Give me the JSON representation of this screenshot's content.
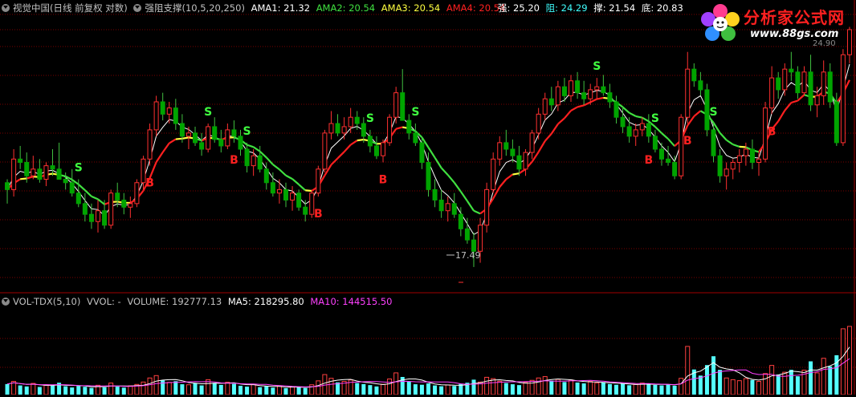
{
  "main_header": {
    "title": "视觉中国(日线 前复权 对数)",
    "indicator": "强阻支撑(10,5,20,250)",
    "ama1_label": "AMA1: 21.32",
    "ama2_label": "AMA2: 20.54",
    "ama3_label": "AMA3: 20.54",
    "ama4_label": "AMA4: 20.54"
  },
  "sr_header": {
    "strong_label": "强: 25.20",
    "resist_label": "阻: 24.29",
    "support_label": "撑: 21.54",
    "bottom_label": "底: 20.83"
  },
  "volume_header": {
    "indicator": "VOL-TDX(5,10)",
    "vvol_label": "VVOL: -",
    "volume_label": "VOLUME: 192777.13",
    "ma5_label": "MA5: 218295.80",
    "ma10_label": "MA10: 144515.50"
  },
  "logo": {
    "title": "分析家公式网",
    "url": "www.88gs.com"
  },
  "colors": {
    "up": "#ff3030",
    "down": "#00a400",
    "volume_up": "#ff4040",
    "volume_down": "#54ffff",
    "ama_white": "#ffffff",
    "ama_green": "#40e040",
    "ama_yellow": "#ffff40",
    "ama_red": "#ff2020",
    "grid": "#7a0000",
    "ma5": "#ffffff",
    "ma10": "#ff40ff",
    "signal_s": "#40ff40",
    "signal_b": "#ff2020"
  },
  "annotations": {
    "low_price": "17.49",
    "high_price": "24.90"
  },
  "signals": [
    {
      "text": "S",
      "index": 11
    },
    {
      "text": "S",
      "index": 31
    },
    {
      "text": "S",
      "index": 37
    },
    {
      "text": "S",
      "index": 56
    },
    {
      "text": "S",
      "index": 63
    },
    {
      "text": "S",
      "index": 91
    },
    {
      "text": "S",
      "index": 100
    },
    {
      "text": "S",
      "index": 109
    },
    {
      "text": "B",
      "index": 22
    },
    {
      "text": "B",
      "index": 35
    },
    {
      "text": "B",
      "index": 48
    },
    {
      "text": "B",
      "index": 58
    },
    {
      "text": "B",
      "index": 99
    },
    {
      "text": "B",
      "index": 105
    },
    {
      "text": "B",
      "index": 118
    }
  ],
  "chart_data": {
    "type": "candlestick",
    "note": "Approximate price (yuan) and volume bars read from screenshot",
    "ylim": [
      16.9,
      25.3
    ],
    "volume_ylim": [
      0,
      520000
    ],
    "candles": [
      [
        19.8,
        19.9,
        19.2,
        19.6
      ],
      [
        19.6,
        20.8,
        19.4,
        20.5
      ],
      [
        20.5,
        20.9,
        20.2,
        20.4
      ],
      [
        20.4,
        20.7,
        19.8,
        20.0
      ],
      [
        20.0,
        20.6,
        19.9,
        20.2
      ],
      [
        20.2,
        20.5,
        19.8,
        19.9
      ],
      [
        19.9,
        20.4,
        19.7,
        20.3
      ],
      [
        20.3,
        20.8,
        20.0,
        20.2
      ],
      [
        20.2,
        21.0,
        19.9,
        19.9
      ],
      [
        19.9,
        20.1,
        19.6,
        19.8
      ],
      [
        19.8,
        20.2,
        19.4,
        19.5
      ],
      [
        19.5,
        19.9,
        19.1,
        19.2
      ],
      [
        19.2,
        19.5,
        18.7,
        18.9
      ],
      [
        18.9,
        19.2,
        18.5,
        18.7
      ],
      [
        18.7,
        19.3,
        18.4,
        19.0
      ],
      [
        19.0,
        19.3,
        18.5,
        18.6
      ],
      [
        18.6,
        19.6,
        18.5,
        19.5
      ],
      [
        19.5,
        19.8,
        19.1,
        19.3
      ],
      [
        19.3,
        19.5,
        18.9,
        19.1
      ],
      [
        19.1,
        19.4,
        18.8,
        19.2
      ],
      [
        19.2,
        19.9,
        19.1,
        19.8
      ],
      [
        19.8,
        20.6,
        19.6,
        20.5
      ],
      [
        20.5,
        21.6,
        20.3,
        21.4
      ],
      [
        21.4,
        22.5,
        21.2,
        22.3
      ],
      [
        22.3,
        22.6,
        21.7,
        21.9
      ],
      [
        21.9,
        22.3,
        21.6,
        22.1
      ],
      [
        22.1,
        22.4,
        21.4,
        21.6
      ],
      [
        21.6,
        21.9,
        21.0,
        21.2
      ],
      [
        21.2,
        21.5,
        20.8,
        21.3
      ],
      [
        21.3,
        21.5,
        20.9,
        21.0
      ],
      [
        21.0,
        21.3,
        20.6,
        20.8
      ],
      [
        20.8,
        21.6,
        20.7,
        21.5
      ],
      [
        21.5,
        21.8,
        21.0,
        21.1
      ],
      [
        21.1,
        21.4,
        20.7,
        20.9
      ],
      [
        20.9,
        21.6,
        20.8,
        21.4
      ],
      [
        21.4,
        21.7,
        21.0,
        21.2
      ],
      [
        21.2,
        21.4,
        20.6,
        20.8
      ],
      [
        20.8,
        21.0,
        20.1,
        20.3
      ],
      [
        20.3,
        20.8,
        20.0,
        20.6
      ],
      [
        20.6,
        20.9,
        20.1,
        20.2
      ],
      [
        20.2,
        20.4,
        19.6,
        19.8
      ],
      [
        19.8,
        20.1,
        19.4,
        19.5
      ],
      [
        19.5,
        19.9,
        19.2,
        19.6
      ],
      [
        19.6,
        19.8,
        19.1,
        19.3
      ],
      [
        19.3,
        19.7,
        19.0,
        19.5
      ],
      [
        19.5,
        19.6,
        19.0,
        19.1
      ],
      [
        19.1,
        19.3,
        18.7,
        18.9
      ],
      [
        18.9,
        19.6,
        18.8,
        19.5
      ],
      [
        19.5,
        20.3,
        19.4,
        20.2
      ],
      [
        20.2,
        21.4,
        20.1,
        21.3
      ],
      [
        21.3,
        22.0,
        21.1,
        21.6
      ],
      [
        21.6,
        21.9,
        21.2,
        21.3
      ],
      [
        21.3,
        21.8,
        21.1,
        21.5
      ],
      [
        21.5,
        22.1,
        21.3,
        21.8
      ],
      [
        21.8,
        22.0,
        21.4,
        21.6
      ],
      [
        21.6,
        21.8,
        21.0,
        21.2
      ],
      [
        21.2,
        21.4,
        20.7,
        20.9
      ],
      [
        20.9,
        21.2,
        20.5,
        20.6
      ],
      [
        20.6,
        21.1,
        20.4,
        21.0
      ],
      [
        21.0,
        21.9,
        20.9,
        21.8
      ],
      [
        21.8,
        22.8,
        21.6,
        22.6
      ],
      [
        22.6,
        23.4,
        22.4,
        21.7
      ],
      [
        21.7,
        21.9,
        21.1,
        21.3
      ],
      [
        21.3,
        21.6,
        20.9,
        21.0
      ],
      [
        21.0,
        21.2,
        20.2,
        20.4
      ],
      [
        20.4,
        20.7,
        19.4,
        19.6
      ],
      [
        19.6,
        19.9,
        19.1,
        19.3
      ],
      [
        19.3,
        19.6,
        18.8,
        19.0
      ],
      [
        19.0,
        19.4,
        18.7,
        19.2
      ],
      [
        19.2,
        19.5,
        18.8,
        18.9
      ],
      [
        18.9,
        19.1,
        18.3,
        18.5
      ],
      [
        18.5,
        18.8,
        18.1,
        18.2
      ],
      [
        18.2,
        18.4,
        17.49,
        17.9
      ],
      [
        17.9,
        18.8,
        17.6,
        18.6
      ],
      [
        18.6,
        19.8,
        18.4,
        19.6
      ],
      [
        19.6,
        20.7,
        19.5,
        20.5
      ],
      [
        20.5,
        21.2,
        20.3,
        21.0
      ],
      [
        21.0,
        21.4,
        20.6,
        20.8
      ],
      [
        20.8,
        21.1,
        20.4,
        20.6
      ],
      [
        20.6,
        20.9,
        20.0,
        20.2
      ],
      [
        20.2,
        20.8,
        20.0,
        20.7
      ],
      [
        20.7,
        21.4,
        20.5,
        21.3
      ],
      [
        21.3,
        22.1,
        21.1,
        21.9
      ],
      [
        21.9,
        22.6,
        21.7,
        22.4
      ],
      [
        22.4,
        22.8,
        22.0,
        22.2
      ],
      [
        22.2,
        23.0,
        22.0,
        22.8
      ],
      [
        22.8,
        23.1,
        22.3,
        22.5
      ],
      [
        22.5,
        23.2,
        22.3,
        23.0
      ],
      [
        23.0,
        23.3,
        22.4,
        22.6
      ],
      [
        22.6,
        23.0,
        22.2,
        22.4
      ],
      [
        22.4,
        22.9,
        22.2,
        22.7
      ],
      [
        22.7,
        23.1,
        22.4,
        22.8
      ],
      [
        22.8,
        23.2,
        22.5,
        22.6
      ],
      [
        22.6,
        22.9,
        22.1,
        22.3
      ],
      [
        22.3,
        22.5,
        21.6,
        21.8
      ],
      [
        21.8,
        22.1,
        21.3,
        21.5
      ],
      [
        21.5,
        21.8,
        21.0,
        21.2
      ],
      [
        21.2,
        21.6,
        20.9,
        21.4
      ],
      [
        21.4,
        21.8,
        21.2,
        21.6
      ],
      [
        21.6,
        21.9,
        21.0,
        21.2
      ],
      [
        21.2,
        21.4,
        20.7,
        20.8
      ],
      [
        20.8,
        21.0,
        20.3,
        20.5
      ],
      [
        20.5,
        20.9,
        20.3,
        20.4
      ],
      [
        20.4,
        20.6,
        19.9,
        20.0
      ],
      [
        20.0,
        21.9,
        19.9,
        21.8
      ],
      [
        21.8,
        24.0,
        21.6,
        23.4
      ],
      [
        23.4,
        23.6,
        22.8,
        23.0
      ],
      [
        23.0,
        23.3,
        22.5,
        22.7
      ],
      [
        22.7,
        22.9,
        21.2,
        21.4
      ],
      [
        21.4,
        21.6,
        20.4,
        20.6
      ],
      [
        20.6,
        20.8,
        19.8,
        20.0
      ],
      [
        20.0,
        20.4,
        19.6,
        20.2
      ],
      [
        20.2,
        20.5,
        19.9,
        20.4
      ],
      [
        20.4,
        20.8,
        20.1,
        20.6
      ],
      [
        20.6,
        21.0,
        20.3,
        20.8
      ],
      [
        20.8,
        21.1,
        20.2,
        20.4
      ],
      [
        20.4,
        20.7,
        20.0,
        20.5
      ],
      [
        20.5,
        22.3,
        20.4,
        22.1
      ],
      [
        22.1,
        23.5,
        21.9,
        23.1
      ],
      [
        23.1,
        23.3,
        22.4,
        22.7
      ],
      [
        22.7,
        23.6,
        22.5,
        23.4
      ],
      [
        23.4,
        24.0,
        23.0,
        23.3
      ],
      [
        23.3,
        23.5,
        22.4,
        22.6
      ],
      [
        22.6,
        23.5,
        22.5,
        23.3
      ],
      [
        23.3,
        23.9,
        22.0,
        22.2
      ],
      [
        22.2,
        22.8,
        21.8,
        22.5
      ],
      [
        22.5,
        23.7,
        22.2,
        23.3
      ],
      [
        23.3,
        23.6,
        22.1,
        22.3
      ],
      [
        22.3,
        22.6,
        20.9,
        21.0
      ],
      [
        21.0,
        24.1,
        20.9,
        23.9
      ],
      [
        23.9,
        24.9,
        23.6,
        24.8
      ]
    ],
    "volumes": [
      62000,
      78000,
      54000,
      48000,
      66000,
      45000,
      58000,
      52000,
      70000,
      49000,
      42000,
      51000,
      46000,
      39000,
      55000,
      43000,
      68000,
      47000,
      41000,
      52000,
      60000,
      74000,
      98000,
      112000,
      84000,
      72000,
      79000,
      61000,
      58000,
      66000,
      54000,
      88000,
      69000,
      57000,
      73000,
      63000,
      52000,
      47000,
      59000,
      44000,
      49000,
      41000,
      50000,
      38000,
      46000,
      43000,
      39000,
      58000,
      81000,
      118000,
      96000,
      72000,
      78000,
      86000,
      68000,
      62000,
      56000,
      48000,
      61000,
      92000,
      128000,
      104000,
      76000,
      61000,
      58000,
      66000,
      54000,
      49000,
      57000,
      51000,
      63000,
      70000,
      88000,
      74000,
      102000,
      94000,
      79000,
      68000,
      61000,
      56000,
      72000,
      84000,
      98000,
      106000,
      82000,
      90000,
      74000,
      86000,
      71000,
      66000,
      78000,
      69000,
      74000,
      62000,
      58000,
      64000,
      55000,
      60000,
      68000,
      63000,
      57000,
      54000,
      60000,
      52000,
      96000,
      284000,
      148000,
      112000,
      174000,
      226000,
      146000,
      98000,
      88000,
      82000,
      94000,
      86000,
      78000,
      124000,
      172000,
      118000,
      132000,
      146000,
      108000,
      144000,
      196000,
      128000,
      214000,
      166000,
      232000,
      388000,
      402000
    ]
  }
}
